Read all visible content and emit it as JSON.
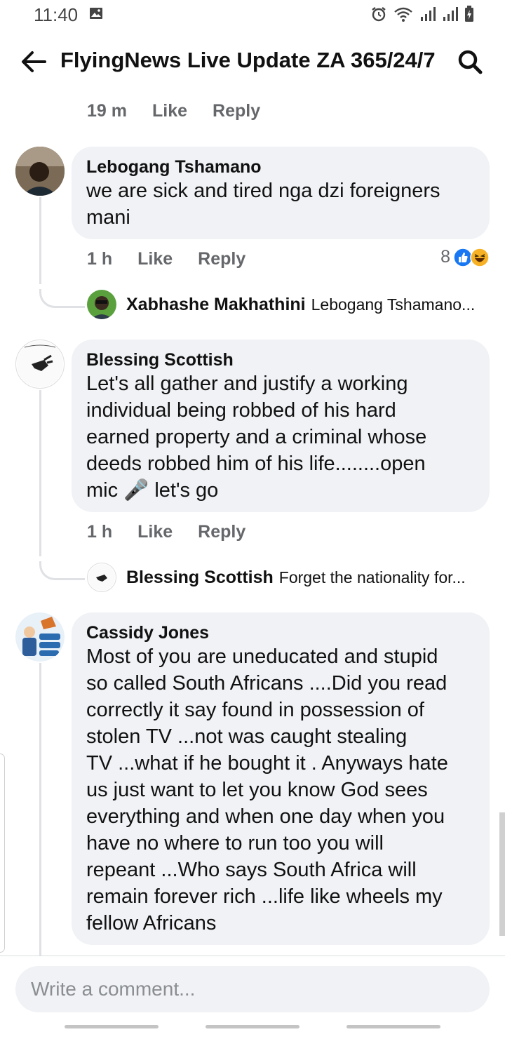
{
  "status_bar": {
    "time": "11:40"
  },
  "header": {
    "title": "FlyingNews Live Update ZA 365/24/7"
  },
  "top_meta": {
    "time": "19 m",
    "like": "Like",
    "reply": "Reply"
  },
  "comments": [
    {
      "author": "Lebogang Tshamano",
      "lines": [
        "we are sick and tired nga dzi foreigners",
        "mani"
      ],
      "time": "1 h",
      "like": "Like",
      "reply": "Reply",
      "reaction_count": "8",
      "reply_preview": {
        "name": "Xabhashe Makhathini",
        "text": "Lebogang Tshamano..."
      }
    },
    {
      "author": "Blessing Scottish",
      "lines": [
        "Let's all gather and justify a working",
        "individual being robbed of his hard",
        "earned property and a criminal whose",
        "deeds robbed him of his life........open",
        "mic 🎤 let's go"
      ],
      "time": "1 h",
      "like": "Like",
      "reply": "Reply",
      "reply_preview": {
        "name": "Blessing Scottish",
        "text": "Forget the nationality for..."
      }
    },
    {
      "author": "Cassidy Jones",
      "lines": [
        "Most of you are uneducated and stupid",
        "so called South Africans ....Did you read",
        "correctly it say found in possession of",
        "stolen TV ...not was caught stealing",
        "TV ...what if he bought it .  Anyways hate",
        "us just want to let you know God sees",
        "everything and when one day when you",
        "have no where to run too you will",
        "repeant ...Who says South Africa will",
        "remain forever rich ...life like wheels my",
        "fellow Africans"
      ]
    }
  ],
  "composer": {
    "placeholder": "Write a comment..."
  },
  "colors": {
    "bubble": "#f0f2f5",
    "meta_text": "#65676b",
    "like_blue": "#1877f2",
    "haha_yellow": "#f7b125"
  }
}
